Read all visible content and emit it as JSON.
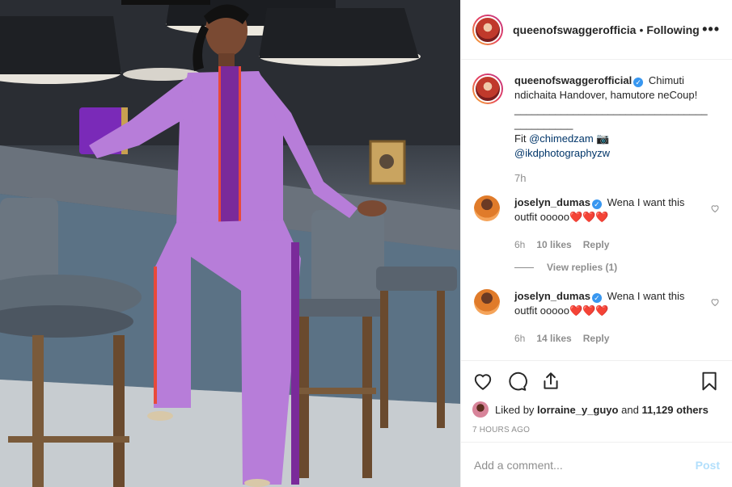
{
  "header": {
    "username": "queenofswaggerofficia",
    "separator": "•",
    "follow_status": "Following",
    "more_label": "•••"
  },
  "caption": {
    "username": "queenofswaggerofficial",
    "text": "Chimuti ndichaita Handover, hamutore neCoup!",
    "divider": "___________________________________________",
    "fit_label": "Fit",
    "mention1": "@chimedzam",
    "camera_emoji": "📷",
    "mention2": "@ikdphotographyzw",
    "time": "7h"
  },
  "comments": [
    {
      "username": "joselyn_dumas",
      "text": "Wena I want this outfit ooooo",
      "hearts": "❤️❤️❤️",
      "time": "6h",
      "likes": "10 likes",
      "reply": "Reply",
      "view_replies": "View replies (1)"
    },
    {
      "username": "joselyn_dumas",
      "text": "Wena I want this outfit ooooo",
      "hearts": "❤️❤️❤️",
      "time": "6h",
      "likes": "14 likes",
      "reply": "Reply"
    }
  ],
  "likes": {
    "prefix": "Liked by",
    "user": "lorraine_y_guyo",
    "and": "and",
    "others": "11,129 others"
  },
  "posted": "7 HOURS AGO",
  "add_comment": {
    "placeholder": "Add a comment...",
    "post_label": "Post"
  },
  "colors": {
    "accent": "#3897f0",
    "muted": "#8e8e8e",
    "outfit": "#b77dd9",
    "stripe": "#7a2a9a",
    "post_disabled": "#b2dffc"
  },
  "icons": {
    "like": "heart-icon",
    "comment": "comment-icon",
    "share": "share-icon",
    "save": "bookmark-icon"
  }
}
